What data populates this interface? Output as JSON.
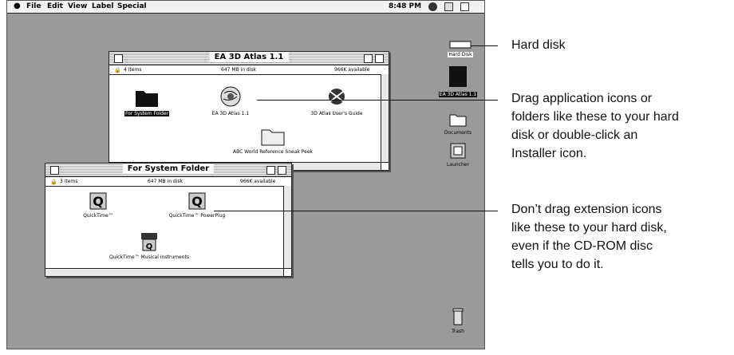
{
  "menubar": {
    "apple": "●",
    "items": [
      "File",
      "Edit",
      "View",
      "Label",
      "Special"
    ],
    "clock": "8:48 PM"
  },
  "cd_window": {
    "title": "EA 3D Atlas 1.1",
    "items_count": "4 items",
    "in_disk": "647 MB in disk",
    "available": "966K available",
    "icons": {
      "folder": "For System Folder",
      "app": "EA 3D Atlas 1.1",
      "guide": "3D Atlas User's Guide",
      "ref": "ABC World Reference Sneak Peek"
    }
  },
  "sys_window": {
    "title": "For System Folder",
    "items_count": "3 items",
    "in_disk": "647 MB in disk",
    "available": "966K available",
    "icons": {
      "qt": "QuickTime™",
      "qtpp": "QuickTime™ PowerPlug",
      "qtmi": "QuickTime™ Musical Instruments"
    }
  },
  "desktop": {
    "hard_disk": "Hard Disk",
    "cd": "EA 3D Atlas 1.1",
    "documents": "Documents",
    "launcher": "Launcher",
    "trash": "Trash"
  },
  "callouts": {
    "hard_disk": "Hard disk",
    "drag_apps": [
      "Drag application icons or",
      "folders like these to your hard",
      "disk or double-click an",
      "Installer icon."
    ],
    "dont_drag": [
      "Don’t drag extension icons",
      "like these to your hard disk,",
      "even if the CD-ROM disc",
      "tells you to do it."
    ]
  }
}
